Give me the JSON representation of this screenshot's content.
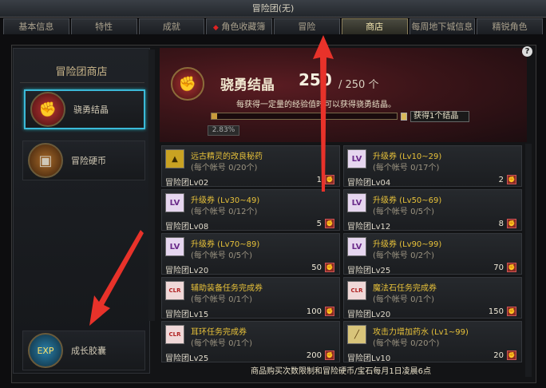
{
  "window": {
    "title": "冒险团(无)"
  },
  "tabs": [
    {
      "label": "基本信息"
    },
    {
      "label": "特性"
    },
    {
      "label": "成就"
    },
    {
      "label": "角色收藏簿"
    },
    {
      "label": "冒险"
    },
    {
      "label": "商店"
    },
    {
      "label": "每周地下城信息"
    },
    {
      "label": "精锐角色"
    }
  ],
  "sidebar": {
    "title": "冒险团商店",
    "items": [
      {
        "label": "骁勇结晶",
        "icon": "fist-icon"
      },
      {
        "label": "冒险硬币",
        "icon": "treasure-chest-icon"
      },
      {
        "label": "成长胶囊",
        "icon": "exp-capsule-icon"
      }
    ]
  },
  "hero": {
    "name": "骁勇结晶",
    "count": "250",
    "max": "/ 250 个",
    "description": "每获得一定量的经验值时可以获得骁勇结晶。",
    "progress_percent": "2.83%",
    "progress_fraction": 0.0283,
    "goal": "获得1个结晶"
  },
  "items": [
    {
      "name": "远古精灵的改良秘药",
      "limit": "(每个帐号 0/20个)",
      "level": "冒险团Lv02",
      "price": "1",
      "icon": "potion-icon"
    },
    {
      "name": "升级券 (Lv10~29)",
      "limit": "(每个帐号 0/17个)",
      "level": "冒险团Lv04",
      "price": "2",
      "icon": "level-ticket-icon"
    },
    {
      "name": "升级券 (Lv30~49)",
      "limit": "(每个帐号 0/12个)",
      "level": "冒险团Lv08",
      "price": "5",
      "icon": "level-ticket-icon"
    },
    {
      "name": "升级券 (Lv50~69)",
      "limit": "(每个帐号 0/5个)",
      "level": "冒险团Lv12",
      "price": "8",
      "icon": "level-ticket-icon"
    },
    {
      "name": "升级券 (Lv70~89)",
      "limit": "(每个帐号 0/5个)",
      "level": "冒险团Lv20",
      "price": "50",
      "icon": "level-ticket-icon"
    },
    {
      "name": "升级券 (Lv90~99)",
      "limit": "(每个帐号 0/2个)",
      "level": "冒险团Lv25",
      "price": "70",
      "icon": "level-ticket-icon"
    },
    {
      "name": "辅助装备任务完成券",
      "limit": "(每个帐号 0/1个)",
      "level": "冒险团Lv15",
      "price": "100",
      "icon": "clear-ticket-icon"
    },
    {
      "name": "魔法石任务完成券",
      "limit": "(每个帐号 0/1个)",
      "level": "冒险团Lv20",
      "price": "150",
      "icon": "clear-ticket-icon"
    },
    {
      "name": "耳环任务完成券",
      "limit": "(每个帐号 0/1个)",
      "level": "冒险团Lv25",
      "price": "200",
      "icon": "clear-ticket-icon"
    },
    {
      "name": "攻击力增加药水 (Lv1~99)",
      "limit": "(每个帐号 0/20个)",
      "level": "冒险团Lv10",
      "price": "20",
      "icon": "attack-potion-icon"
    }
  ],
  "footer": {
    "note": "商品购买次数限制和冒险硬币/宝石每月1日凌晨6点"
  },
  "colors": {
    "accent": "#3bb9d8",
    "arrow": "#e8322a",
    "gold_text": "#e8c23a"
  }
}
